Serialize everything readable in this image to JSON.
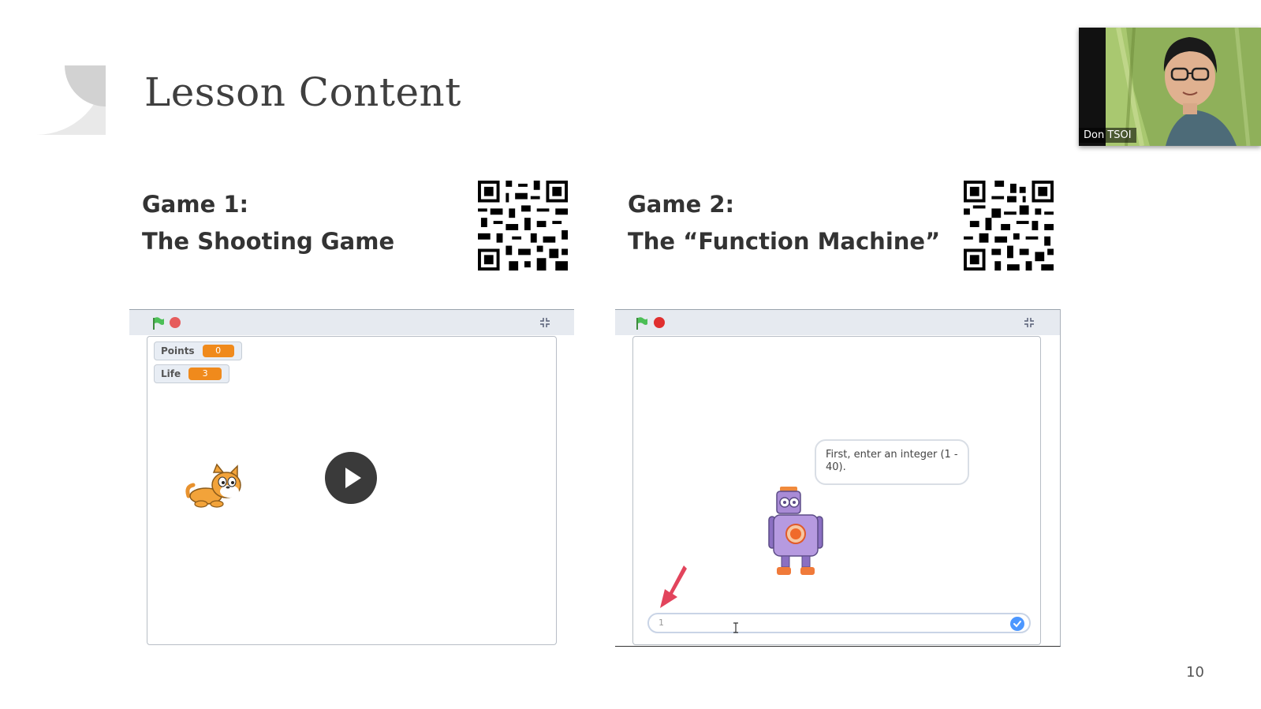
{
  "slide": {
    "title": "Lesson Content",
    "page_number": "10"
  },
  "game1": {
    "label": "Game 1:",
    "name": "The Shooting Game",
    "monitors": [
      {
        "label": "Points",
        "value": "0"
      },
      {
        "label": "Life",
        "value": "3"
      }
    ]
  },
  "game2": {
    "label": "Game 2:",
    "name": "The “Function Machine”",
    "speech": "First, enter an integer (1 - 40).",
    "answer_value": "1"
  },
  "video": {
    "participant_name": "Don TSOI"
  },
  "colors": {
    "stop": "#e65c5c",
    "flag": "#4cbf56",
    "monitor_value": "#f08a1c",
    "check": "#4c97ff"
  }
}
